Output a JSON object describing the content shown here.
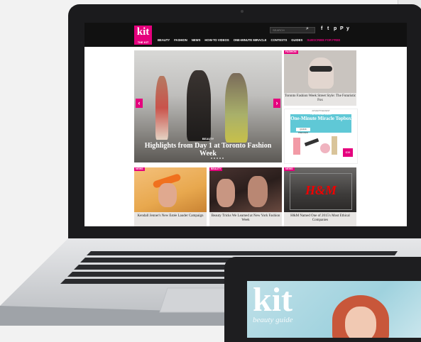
{
  "site": {
    "logo": "kit",
    "logo_sub": "THE KIT",
    "search_placeholder": "SEARCH",
    "social": [
      "f",
      "t",
      "p",
      "P",
      "y"
    ],
    "nav": [
      "BEAUTY",
      "FASHION",
      "NEWS",
      "HOW-TO VIDEOS",
      "ONE-MINUTE MIRACLE",
      "CONTESTS",
      "GUIDES"
    ],
    "nav_extra": "SUBSCRIBE FOR FREE"
  },
  "hero": {
    "category": "BEAUTY",
    "title": "Highlights from Day 1 at Toronto Fashion Week",
    "prev": "‹",
    "next": "›"
  },
  "side_story": {
    "tag": "FASHION",
    "caption": "Toronto Fashion Week Street Style: The Futuristic Fox"
  },
  "promo": {
    "label": "ADVERTISEMENT",
    "kicker": "The Kit Limited Edition",
    "title": "One-Minute Miracle Topbox",
    "button": "QUICK PREVIEW",
    "price": "$38"
  },
  "cards": [
    {
      "tag": "NEWS",
      "caption": "Kendall Jenner's New Estée Lauder Campaign",
      "bg": "#e9b25a"
    },
    {
      "tag": "BEAUTY",
      "caption": "Beauty Tricks We Learned at New York Fashion Week",
      "bg": "#3a2c2a"
    },
    {
      "tag": "NEWS",
      "caption": "H&M Named One of 2015's Most Ethical Companies",
      "bg": "#4a4848"
    }
  ],
  "hm_sign": "H&M",
  "tablet": {
    "logo": "kit",
    "subtitle": "beauty guide"
  },
  "colors": {
    "brand_pink": "#e5007d",
    "topbar": "#111111",
    "promo_teal": "#5fc8d6"
  }
}
